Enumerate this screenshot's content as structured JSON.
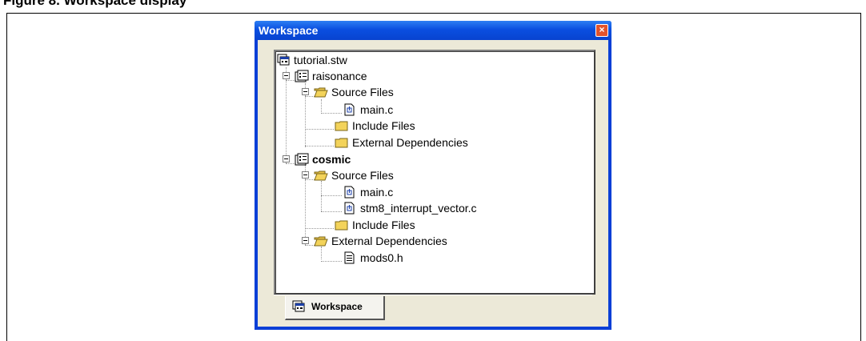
{
  "caption": {
    "text": "Figure 8. Workspace display"
  },
  "window": {
    "title": "Workspace",
    "close_label": "×"
  },
  "tree": {
    "root": "tutorial.stw",
    "project1": {
      "name": "raisonance",
      "source_folder": "Source Files",
      "source_file": "main.c",
      "include_folder": "Include Files",
      "external_folder": "External Dependencies"
    },
    "project2": {
      "name": "cosmic",
      "source_folder": "Source Files",
      "source_file_1": "main.c",
      "source_file_2": "stm8_interrupt_vector.c",
      "include_folder": "Include Files",
      "external_folder": "External Dependencies",
      "external_file": "mods0.h"
    }
  },
  "tab": {
    "label": "Workspace"
  },
  "icons": {
    "workspace": "workspace-icon",
    "project": "project-icon",
    "folder_open": "folder-open-icon",
    "folder_closed": "folder-closed-icon",
    "source_file": "source-file-icon",
    "header_file": "header-file-icon"
  },
  "colors": {
    "titlebar": "#0a4fe0",
    "client": "#ece9d8",
    "close": "#e2532c",
    "folder": "#f3d35a"
  }
}
